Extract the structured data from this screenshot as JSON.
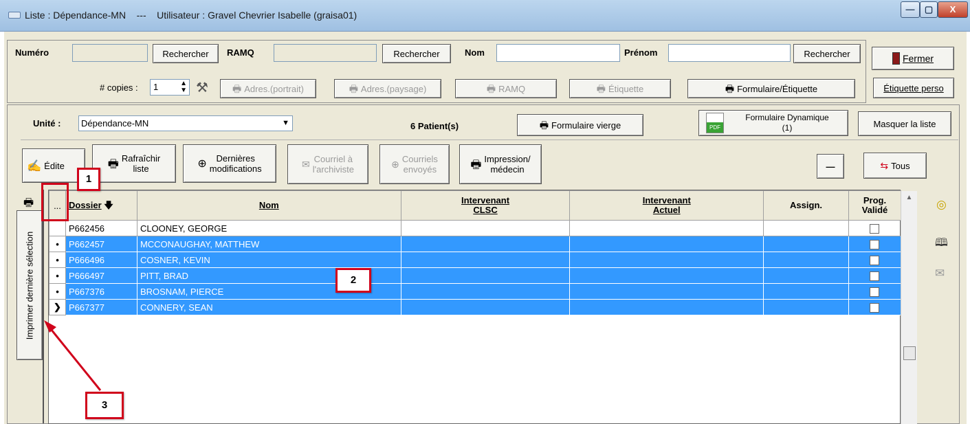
{
  "window": {
    "title": "Liste : Dépendance-MN    ---    Utilisateur : Gravel Chevrier Isabelle (graisa01)",
    "minimize": "—",
    "maximize": "▢",
    "close": "X"
  },
  "search": {
    "numero_label": "Numéro",
    "numero_value": "",
    "rechercher1": "Rechercher",
    "ramq_label": "RAMQ",
    "ramq_value": "",
    "rechercher2": "Rechercher",
    "nom_label": "Nom",
    "nom_value": "",
    "prenom_label": "Prénom",
    "prenom_value": "",
    "rechercher3": "Rechercher",
    "fermer": "Fermer"
  },
  "print": {
    "copies_label": "# copies :",
    "copies_value": "1",
    "adres_portrait": "Adres.(portrait)",
    "adres_paysage": "Adres.(paysage)",
    "ramq": "RAMQ",
    "etiquette": "Étiquette",
    "formulaire_etiquette": "Formulaire/Étiquette",
    "etiquette_perso": "Étiquette perso"
  },
  "unit": {
    "label": "Unité :",
    "value": "Dépendance-MN",
    "patients": "6 Patient(s)",
    "formulaire_vierge": "Formulaire vierge",
    "formulaire_dyn_1": "Formulaire Dynamique",
    "formulaire_dyn_2": "(1)",
    "pdf": "PDF",
    "masquer": "Masquer la liste"
  },
  "toolbar": {
    "editer": "Édite",
    "rafraichir_1": "Rafraîchir",
    "rafraichir_2": "liste",
    "dernieres_1": "Dernières",
    "dernieres_2": "modifications",
    "courriel_1": "Courriel à",
    "courriel_2": "l'archiviste",
    "courriels_1": "Courriels",
    "courriels_2": "envoyés",
    "impression_1": "Impression/",
    "impression_2": "médecin",
    "minus": "—",
    "tous": "Tous"
  },
  "side_tab": "Imprimer dernière sélection",
  "table": {
    "dots": "...",
    "columns": [
      "Dossier",
      "Nom",
      "Intervenant CLSC",
      "Intervenant Actuel",
      "Assign.",
      "Prog. Validé"
    ],
    "col_dossier": "Dossier",
    "col_nom": "Nom",
    "col_clsc_1": "Intervenant",
    "col_clsc_2": "CLSC",
    "col_actuel_1": "Intervenant",
    "col_actuel_2": "Actuel",
    "col_assign": "Assign.",
    "col_prog_1": "Prog.",
    "col_prog_2": "Validé",
    "rows": [
      {
        "marker": "",
        "dossier": "P662456",
        "nom": "CLOONEY, GEORGE",
        "selected": false
      },
      {
        "marker": "•",
        "dossier": "P662457",
        "nom": "MCCONAUGHAY, MATTHEW",
        "selected": true
      },
      {
        "marker": "•",
        "dossier": "P666496",
        "nom": "COSNER, KEVIN",
        "selected": true
      },
      {
        "marker": "•",
        "dossier": "P666497",
        "nom": "PITT, BRAD",
        "selected": true
      },
      {
        "marker": "•",
        "dossier": "P667376",
        "nom": "BROSNAM, PIERCE",
        "selected": true
      },
      {
        "marker": "❯",
        "dossier": "P667377",
        "nom": "CONNERY, SEAN",
        "selected": true
      }
    ]
  },
  "callouts": {
    "c1": "1",
    "c2": "2",
    "c3": "3"
  },
  "colors": {
    "selection": "#3399ff",
    "callout": "#d0021b",
    "titlebar": "#aac9e8"
  }
}
